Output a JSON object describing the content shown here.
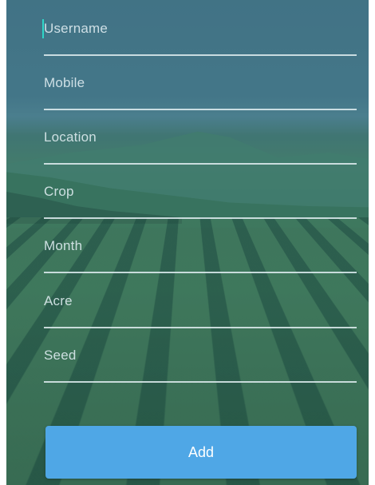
{
  "form": {
    "fields": [
      {
        "label": "Username"
      },
      {
        "label": "Mobile"
      },
      {
        "label": "Location"
      },
      {
        "label": "Crop"
      },
      {
        "label": "Month"
      },
      {
        "label": "Acre"
      },
      {
        "label": "Seed"
      }
    ],
    "submit_label": "Add"
  },
  "colors": {
    "accent": "#4fa7e6",
    "cursor": "#2fd6c8",
    "text": "#e1eef2"
  }
}
